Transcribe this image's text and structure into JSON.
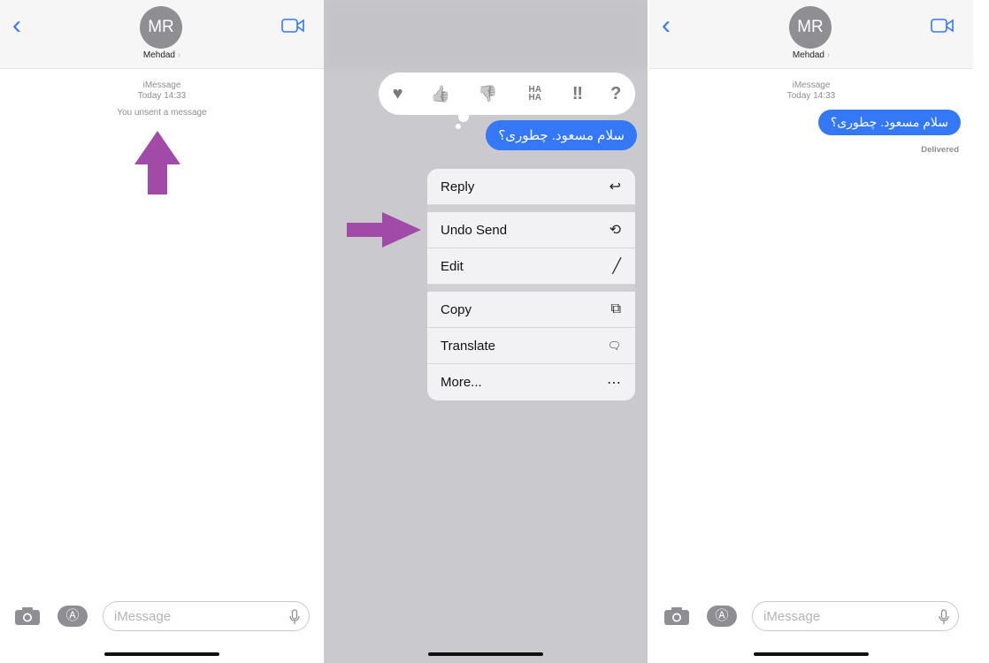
{
  "contact": {
    "initials": "MR",
    "name": "Mehdad",
    "chevron": "›"
  },
  "thread": {
    "service": "iMessage",
    "time": "Today 14:33",
    "unsent_notice": "You unsent a message",
    "delivered": "Delivered"
  },
  "message": {
    "text": "سلام مسعود. چطوری؟"
  },
  "composer": {
    "placeholder": "iMessage"
  },
  "reactions": [
    {
      "icon": "heart-icon",
      "glyph": "♥"
    },
    {
      "icon": "thumbs-up-icon",
      "glyph": "👍"
    },
    {
      "icon": "thumbs-down-icon",
      "glyph": "👎"
    },
    {
      "icon": "haha-icon",
      "glyph": "HA HA"
    },
    {
      "icon": "exclamation-icon",
      "glyph": "‼"
    },
    {
      "icon": "question-icon",
      "glyph": "?"
    }
  ],
  "menu": {
    "reply": "Reply",
    "undo_send": "Undo Send",
    "edit": "Edit",
    "copy": "Copy",
    "translate": "Translate",
    "more": "More..."
  },
  "colors": {
    "accent": "#3478f6",
    "arrow": "#a24aa8"
  }
}
